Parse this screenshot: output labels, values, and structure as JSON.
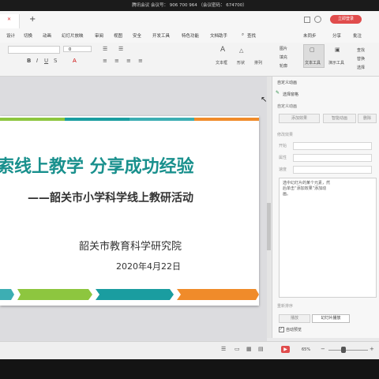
{
  "meeting_bar": {
    "text": "腾讯会议 会议号： 906 700 964  （会议密码： 674700）"
  },
  "tabbar": {
    "new_tab": "+",
    "login_button": "立即登录"
  },
  "menu": {
    "items": [
      "设计",
      "切换",
      "动画",
      "幻灯片放映",
      "审阅",
      "视图",
      "安全",
      "开发工具",
      "特色功能",
      "文档助手"
    ],
    "search": "查找",
    "right_items": [
      "未同步",
      "分享",
      "批注"
    ]
  },
  "ribbon": {
    "font_size": "0",
    "labels": {
      "textbox": "文本框",
      "shapes": "形状",
      "arrange": "排列",
      "picture": "图片",
      "fill": "填充",
      "outline": "轮廓",
      "text_tools": "文本工具",
      "present_tools": "演示工具",
      "find": "查找",
      "replace": "替换",
      "select": "选择"
    }
  },
  "slide": {
    "title": "索线上教学  分享成功经验",
    "subtitle": "——韶关市小学科学线上教研活动",
    "org": "韶关市教育科学研究院",
    "date": "2020年4月22日",
    "stripe_colors": [
      "#8dc63f",
      "#1a9da0",
      "#3daeb3",
      "#f08b2a"
    ],
    "title_color": "#19908d"
  },
  "animation_pane": {
    "header": "自定义动画",
    "select_pane": "选择窗格",
    "custom_animation": "自定义动画",
    "add_effect": "添加效果",
    "smart_animation": "智能动画",
    "delete": "删除",
    "modify_label": "修改效果",
    "start_label": "开始",
    "property_label": "属性",
    "speed_label": "速度",
    "hint": "选中幻灯片的某个元素，然后单击“添加效果”添加动画。",
    "reorder_label": "重新排序",
    "play_button": "播放",
    "slideshow_button": "幻灯片播放",
    "autopreview": "自动预览"
  },
  "statusbar": {
    "zoom": "65%",
    "zoom_level": 0.65
  }
}
